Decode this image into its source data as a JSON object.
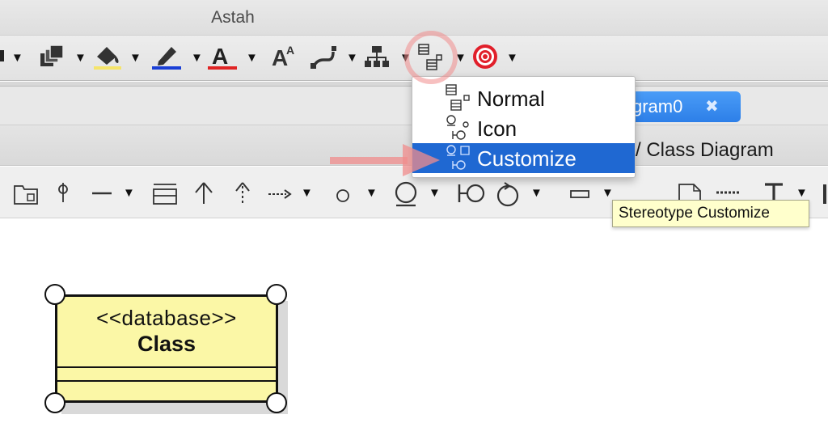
{
  "window": {
    "title": "Astah"
  },
  "tabs": {
    "active_label": "gram0",
    "close_glyph": "✖"
  },
  "breadcrumb": {
    "text": "/ Class Diagram"
  },
  "toolbar": {
    "icons": [
      "previous-dropdown-icon",
      "group-icon",
      "fill-color-icon",
      "line-color-icon",
      "font-color-icon",
      "font-size-icon",
      "line-style-icon",
      "tree-layout-icon",
      "stereotype-display-icon",
      "target-icon"
    ],
    "font_color_glyph": "A",
    "font_size_glyph": "A",
    "font_size_small_glyph": "A",
    "caret": "▼"
  },
  "dropdown": {
    "items": [
      {
        "label": "Normal",
        "icon": "class-normal-icon",
        "selected": false
      },
      {
        "label": "Icon",
        "icon": "class-icon-view-icon",
        "selected": false
      },
      {
        "label": "Customize",
        "icon": "stereotype-customize-icon",
        "selected": true
      }
    ]
  },
  "tooltip": {
    "text": "Stereotype Customize"
  },
  "diagram_class": {
    "stereotype": "<<database>>",
    "name": "Class"
  },
  "colors": {
    "accent_blue": "#1f68d2",
    "tab_blue": "#3b8ff2",
    "class_fill": "#fbf7a6",
    "highlight": "#f08c8c",
    "fill_underline": "#f5e46a",
    "line_underline": "#1a3fd6",
    "font_underline": "#e02424"
  }
}
